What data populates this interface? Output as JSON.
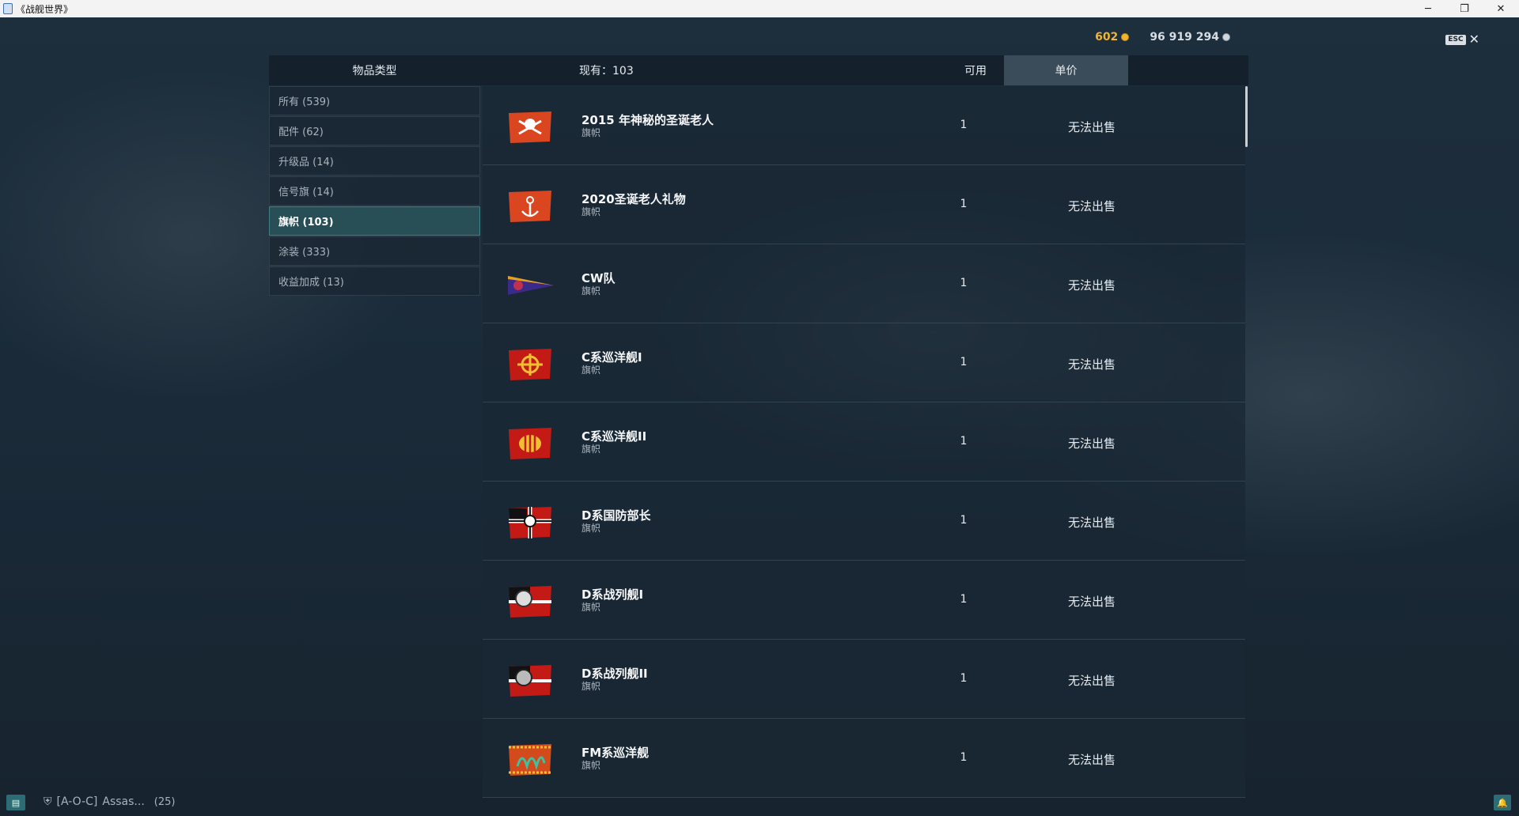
{
  "window": {
    "title": "《战舰世界》",
    "minimize": "─",
    "restore": "❐",
    "close": "✕"
  },
  "currency": {
    "gold": "602",
    "credits": "96 919 294",
    "esc_label": "ESC",
    "close_glyph": "✕"
  },
  "header": {
    "type_label": "物品类型",
    "count_label": "现有：",
    "count_value": "103",
    "avail_label": "可用",
    "price_label": "单价"
  },
  "categories": [
    {
      "label": "所有 (539)",
      "active": false
    },
    {
      "label": "配件 (62)",
      "active": false
    },
    {
      "label": "升级品 (14)",
      "active": false
    },
    {
      "label": "信号旗 (14)",
      "active": false
    },
    {
      "label": "旗帜 (103)",
      "active": true
    },
    {
      "label": "涂装 (333)",
      "active": false
    },
    {
      "label": "收益加成 (13)",
      "active": false
    }
  ],
  "items": [
    {
      "name": "2015 年神秘的圣诞老人",
      "kind": "旗帜",
      "available": "1",
      "price": "无法出售",
      "flag_icon": "santa-skull-flag-icon",
      "flag_color": "#d9461f"
    },
    {
      "name": "2020圣诞老人礼物",
      "kind": "旗帜",
      "available": "1",
      "price": "无法出售",
      "flag_icon": "santa-anchor-flag-icon",
      "flag_color": "#d9461f"
    },
    {
      "name": "CW队",
      "kind": "旗帜",
      "available": "1",
      "price": "无法出售",
      "flag_icon": "pennant-flag-icon",
      "flag_color": "#3a2a8a"
    },
    {
      "name": "C系巡洋舰I",
      "kind": "旗帜",
      "available": "1",
      "price": "无法出售",
      "flag_icon": "chinese-cruiser-flag-icon",
      "flag_color": "#c31a16"
    },
    {
      "name": "C系巡洋舰II",
      "kind": "旗帜",
      "available": "1",
      "price": "无法出售",
      "flag_icon": "chinese-cruiser-flag-icon",
      "flag_color": "#c31a16"
    },
    {
      "name": "D系国防部长",
      "kind": "旗帜",
      "available": "1",
      "price": "无法出售",
      "flag_icon": "german-cross-flag-icon",
      "flag_color": "#c31a16"
    },
    {
      "name": "D系战列舰I",
      "kind": "旗帜",
      "available": "1",
      "price": "无法出售",
      "flag_icon": "german-eagle-flag-icon",
      "flag_color": "#c31a16"
    },
    {
      "name": "D系战列舰II",
      "kind": "旗帜",
      "available": "1",
      "price": "无法出售",
      "flag_icon": "german-eagle-flag-icon",
      "flag_color": "#c31a16"
    },
    {
      "name": "FM系巡洋舰",
      "kind": "旗帜",
      "available": "1",
      "price": "无法出售",
      "flag_icon": "dragon-flag-icon",
      "flag_color": "#d34a1c"
    }
  ],
  "footer": {
    "chat_glyph": "▤",
    "clan_tag": "[A-O-C]",
    "player": "Assas...",
    "count": "(25)",
    "notif_glyph": "🔔"
  }
}
